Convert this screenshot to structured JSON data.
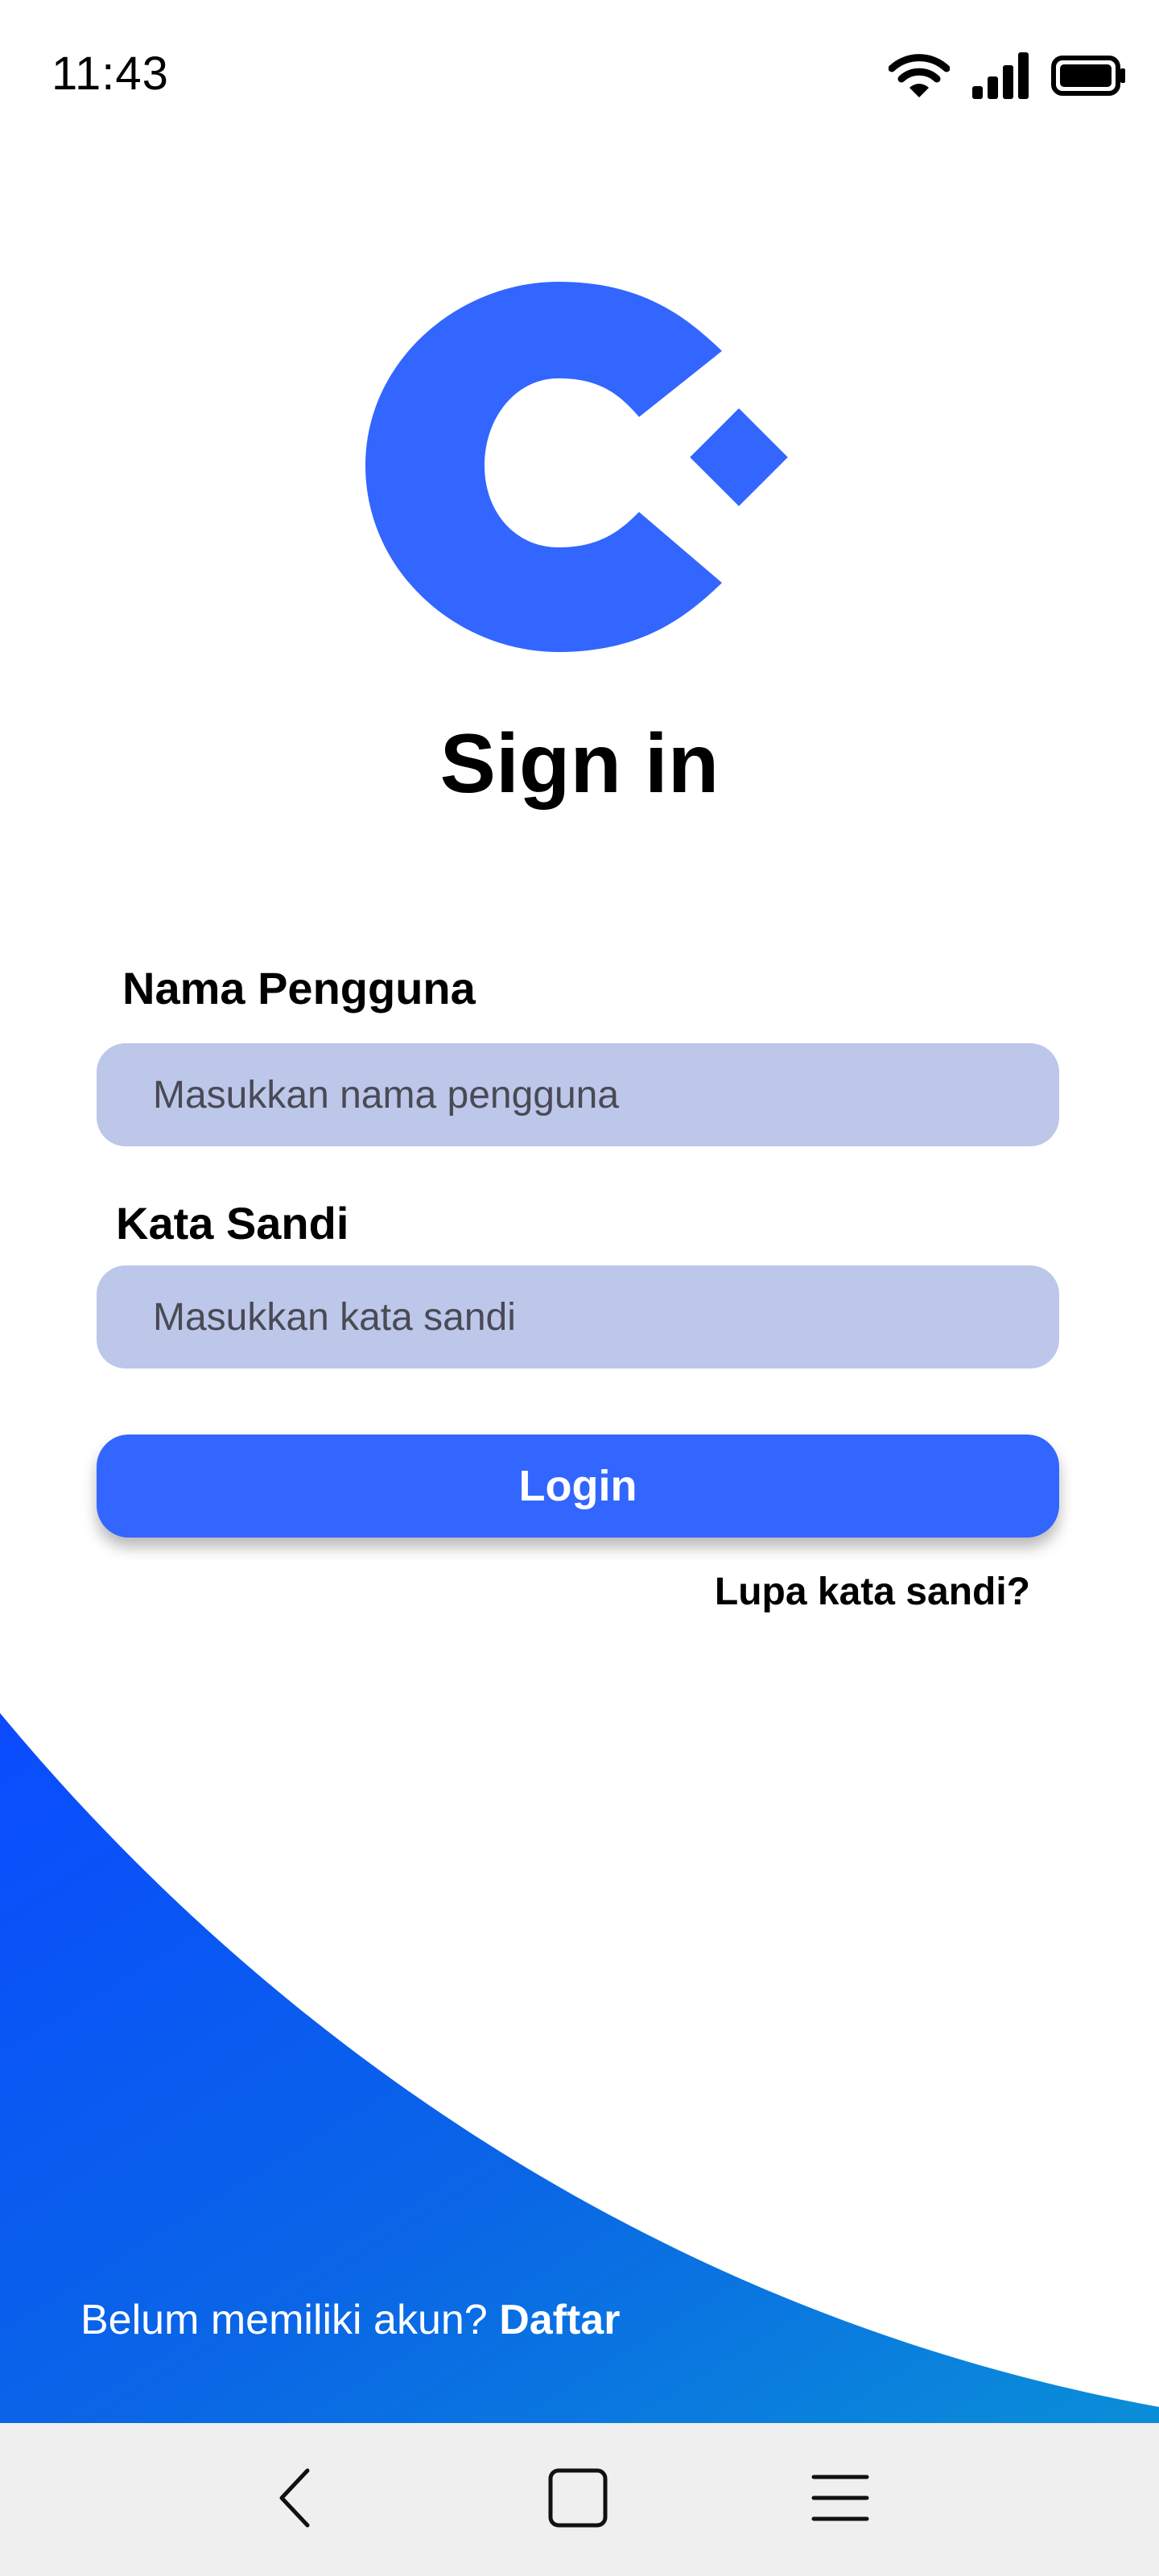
{
  "status_bar": {
    "time": "11:43",
    "icons": [
      "wifi-icon",
      "signal-icon",
      "battery-icon"
    ]
  },
  "colors": {
    "brand_blue": "#3366ff",
    "input_bg": "#bcc7ea",
    "wave_start": "#0a4bff",
    "wave_end": "#0a8ed8",
    "nav_bg": "#efefef"
  },
  "title": "Sign in",
  "form": {
    "username_label": "Nama Pengguna",
    "username_placeholder": "Masukkan nama pengguna",
    "password_label": "Kata Sandi",
    "password_placeholder": "Masukkan kata sandi",
    "login_label": "Login",
    "forgot_label": "Lupa kata sandi?"
  },
  "signup": {
    "prompt": "Belum memiliki akun?",
    "link": "Daftar"
  },
  "nav": {
    "icons": [
      "back-icon",
      "home-icon",
      "menu-icon"
    ]
  }
}
